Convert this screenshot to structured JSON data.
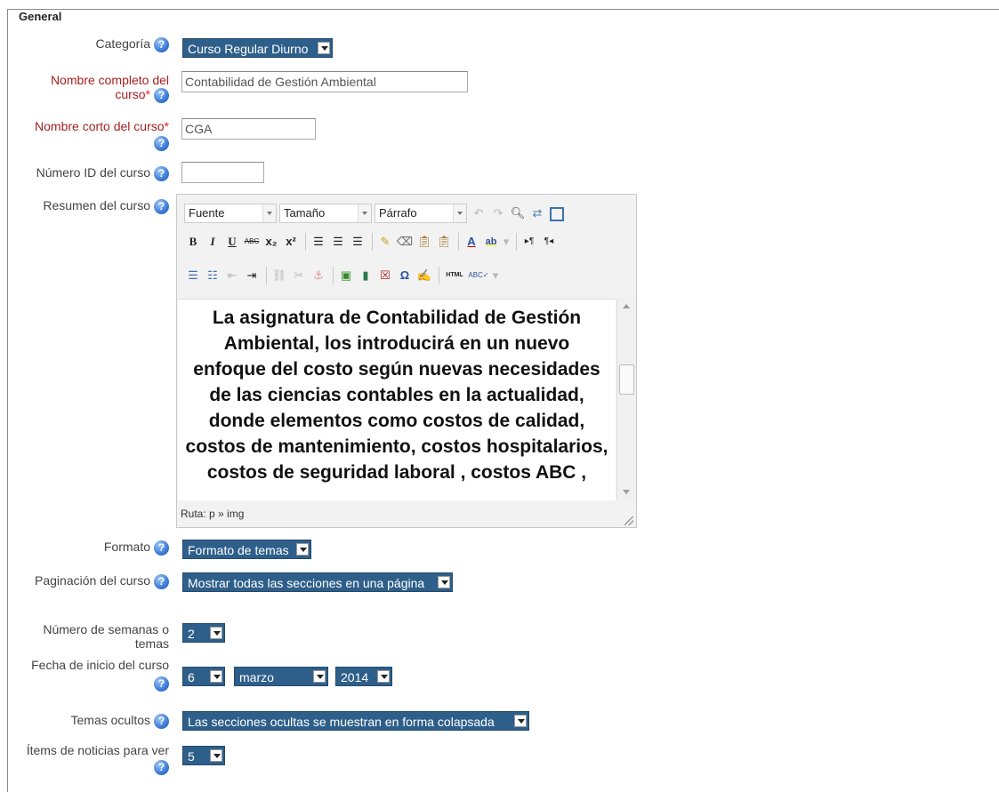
{
  "legend": "General",
  "help_glyph": "?",
  "required_star": "*",
  "fields": {
    "category": {
      "label": "Categoría",
      "value": "Curso Regular Diurno"
    },
    "fullname": {
      "label_line1": "Nombre completo del",
      "label_line2": "curso",
      "value": "Contabilidad de Gestión Ambiental"
    },
    "shortname": {
      "label": "Nombre corto del curso",
      "value": "CGA"
    },
    "idnumber": {
      "label": "Número ID del curso",
      "value": ""
    },
    "summary": {
      "label": "Resumen del curso"
    },
    "format": {
      "label": "Formato",
      "value": "Formato de temas"
    },
    "pagination": {
      "label": "Paginación del curso",
      "value": "Mostrar todas las secciones en una página"
    },
    "numsections": {
      "label_line1": "Número de semanas o",
      "label_line2": "temas",
      "value": "2"
    },
    "startdate": {
      "label": "Fecha de inicio del curso",
      "day": "6",
      "month": "marzo",
      "year": "2014"
    },
    "hiddensections": {
      "label": "Temas ocultos",
      "value": "Las secciones ocultas se muestran en forma colapsada"
    },
    "newsitems": {
      "label": "Ítems de noticias para ver",
      "value": "5"
    }
  },
  "editor": {
    "font_label": "Fuente",
    "size_label": "Tamaño",
    "format_label": "Párrafo",
    "content_text": "La asignatura de Contabilidad de Gestión Ambiental, los introducirá en un nuevo enfoque del costo según nuevas necesidades de las ciencias contables en la actualidad, donde elementos como costos de calidad, costos de mantenimiento, costos hospitalarios, costos de seguridad laboral , costos ABC ,",
    "path_label": "Ruta: p » img",
    "toolbar": {
      "bold": "B",
      "italic": "I",
      "underline": "U",
      "strike": "ABC",
      "subscript": "x₂",
      "superscript": "x²",
      "text_color": "A",
      "highlight": "ab",
      "omega": "Ω",
      "html": "HTML",
      "spell": "ABC"
    }
  },
  "colors": {
    "select_bg": "#2e5f8a",
    "required": "#a52020",
    "help_blue": "#3d7bd6"
  }
}
